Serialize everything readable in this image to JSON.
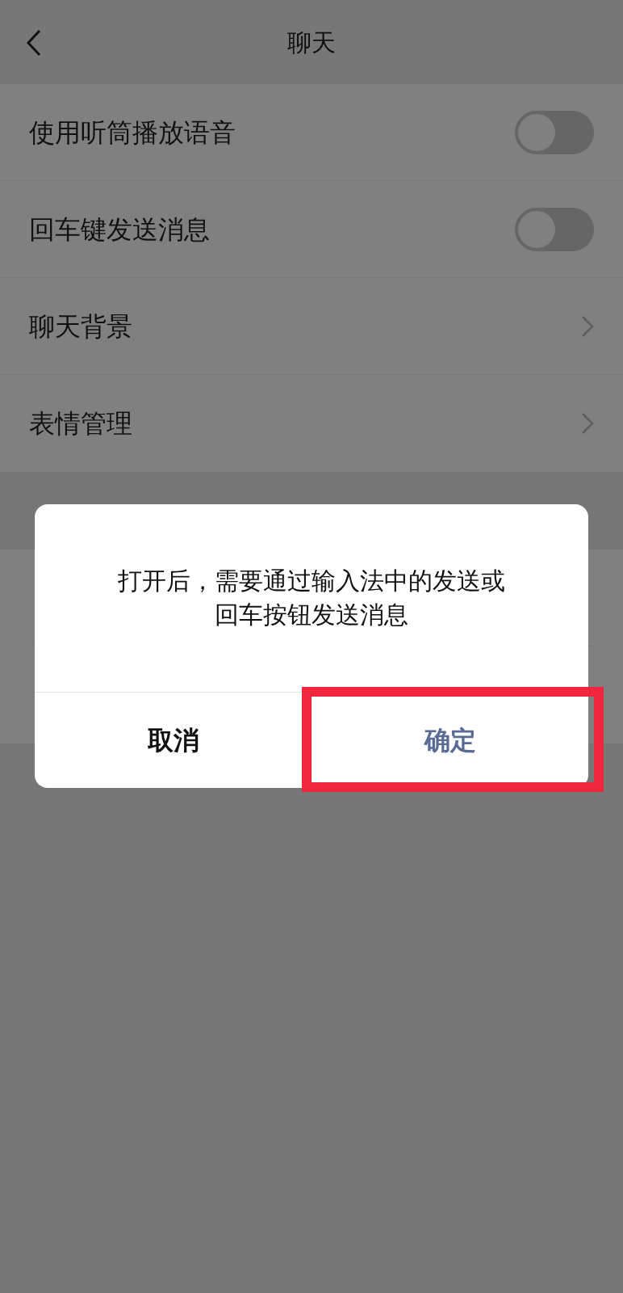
{
  "nav": {
    "title": "聊天"
  },
  "settings": [
    {
      "kind": "toggle",
      "label": "使用听筒播放语音",
      "on": false
    },
    {
      "kind": "toggle",
      "label": "回车键发送消息",
      "on": false
    },
    {
      "kind": "link",
      "label": "聊天背景"
    },
    {
      "kind": "link",
      "label": "表情管理"
    }
  ],
  "dialog": {
    "message": "打开后，需要通过输入法中的发送或回车按钮发送消息",
    "buttons": [
      {
        "kind": "cancel",
        "label": "取消",
        "highlighted": false
      },
      {
        "kind": "confirm",
        "label": "确定",
        "highlighted": true
      }
    ]
  }
}
